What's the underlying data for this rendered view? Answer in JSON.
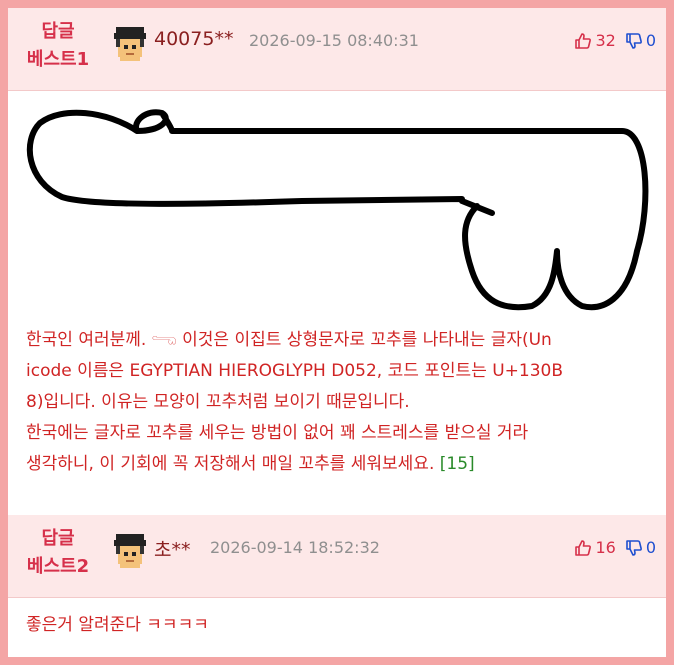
{
  "replies": [
    {
      "best_line1": "답글",
      "best_line2": "베스트1",
      "nickname": "40075**",
      "datetime": "2026-09-15 08:40:31",
      "up": "32",
      "down": "0",
      "lines": [
        "한국인 여러분께. 𓂸 이것은 이집트 상형문자로 꼬추를 나타내는 글자(Un",
        "icode 이름은 EGYPTIAN HIEROGLYPH D052, 코드 포인트는 U+130B",
        "8)입니다. 이유는 모양이 꼬추처럼 보이기 때문입니다.",
        "한국에는 글자로 꼬추를 세우는 방법이 없어 꽤 스트레스를 받으실 거라",
        "생각하니, 이 기회에 꼭 저장해서 매일 꼬추를 세워보세요."
      ],
      "ref": "[15]"
    },
    {
      "best_line1": "답글",
      "best_line2": "베스트2",
      "nickname": "초**",
      "datetime": "2026-09-14 18:52:32",
      "up": "16",
      "down": "0",
      "text": "좋은거 알려준다 ㅋㅋㅋㅋ"
    }
  ],
  "icons": {
    "avatar": "pixel-avatar-icon",
    "thumb_up": "thumbs-up-icon",
    "thumb_down": "thumbs-down-icon"
  },
  "colors": {
    "frame": "#f4a5a5",
    "header_bg": "#fde8e8",
    "best_label": "#d6304a",
    "reply_text": "#d02424",
    "down_count": "#1f4fd0",
    "ref_link": "#2a8a2a"
  }
}
